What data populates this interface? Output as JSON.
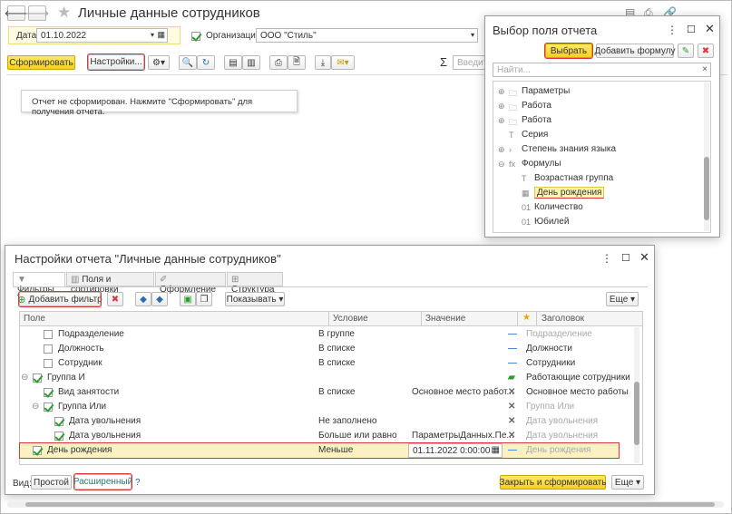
{
  "main": {
    "title": "Личные данные сотрудников",
    "date_label": "Дата:",
    "date_value": "01.10.2022",
    "org_label": "Организация:",
    "org_value": "ООО \"Стиль\"",
    "generate_button": "Сформировать",
    "settings_button": "Настройки...",
    "sigma": "Σ",
    "search_placeholder": "Введите",
    "message": "Отчет не сформирован. Нажмите \"Сформировать\" для получения отчета."
  },
  "field_picker": {
    "title": "Выбор поля отчета",
    "select_button": "Выбрать",
    "add_formula_button": "Добавить формулу",
    "search_placeholder": "Найти...",
    "items": [
      {
        "label": "Параметры",
        "icon": "folder-icon"
      },
      {
        "label": "Работа",
        "icon": "folder-icon"
      },
      {
        "label": "Работа",
        "icon": "folder-icon"
      },
      {
        "label": "Серия",
        "icon": "text-icon"
      },
      {
        "label": "Степень знания языка",
        "icon": "chevron-icon"
      },
      {
        "label": "Формулы",
        "icon": "formula-icon"
      },
      {
        "label": "Возрастная группа",
        "icon": "text-icon"
      },
      {
        "label": "День рождения",
        "icon": "calendar-icon"
      },
      {
        "label": "Количество",
        "icon": "number-icon"
      },
      {
        "label": "Юбилей",
        "icon": "number-icon"
      }
    ]
  },
  "settings": {
    "title": "Настройки отчета \"Личные данные сотрудников\"",
    "tabs": [
      "Фильтры",
      "Поля и сортировки",
      "Оформление",
      "Структура"
    ],
    "add_filter_button": "Добавить фильтр",
    "show_button": "Показывать",
    "more_button": "Еще",
    "columns": {
      "field": "Поле",
      "condition": "Условие",
      "value": "Значение",
      "header": "Заголовок"
    },
    "rows": [
      {
        "field": "Подразделение",
        "condition": "В группе",
        "value": "",
        "header": "Подразделение"
      },
      {
        "field": "Должность",
        "condition": "В списке",
        "value": "",
        "header": "Должности"
      },
      {
        "field": "Сотрудник",
        "condition": "В списке",
        "value": "",
        "header": "Сотрудники"
      },
      {
        "field": "Группа И",
        "condition": "",
        "value": "",
        "header": "Работающие сотрудники"
      },
      {
        "field": "Вид занятости",
        "condition": "В списке",
        "value": "Основное место работ...",
        "header": "Основное место работы"
      },
      {
        "field": "Группа Или",
        "condition": "",
        "value": "",
        "header": "Группа Или"
      },
      {
        "field": "Дата увольнения",
        "condition": "Не заполнено",
        "value": "",
        "header": "Дата увольнения"
      },
      {
        "field": "Дата увольнения",
        "condition": "Больше или равно",
        "value": "ПараметрыДанных.Пе...",
        "header": "Дата увольнения"
      },
      {
        "field": "День рождения",
        "condition": "Меньше",
        "value": "01.11.2022  0:00:00",
        "header": "День рождения"
      }
    ],
    "view_label": "Вид:",
    "simple_button": "Простой",
    "advanced_button": "Расширенный",
    "help": "?",
    "close_generate_button": "Закрыть и сформировать",
    "more_button_bottom": "Еще"
  }
}
